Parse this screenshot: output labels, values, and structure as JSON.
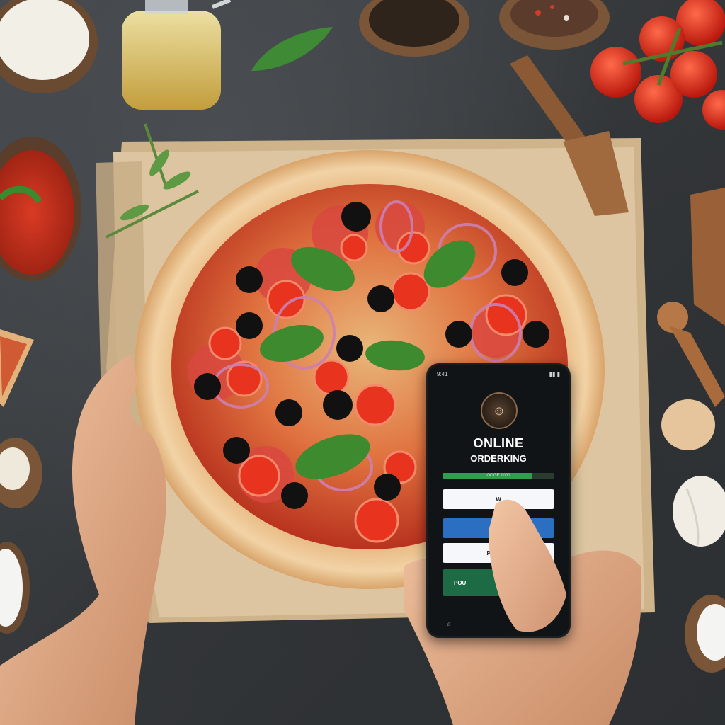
{
  "colors": {
    "background": "#3a3d40",
    "paper": "#d9c3a0",
    "sauce": "#c53d23",
    "crust": "#e9c08c",
    "phone_bg": "#111417",
    "primary_button": "#2b6fc2",
    "order_button": "#1d6b45",
    "accent_green": "#2f9e4f"
  },
  "scene_items": [
    "parmesan-bowl-icon",
    "olive-oil-bottle-icon",
    "basil-leaf-icon",
    "peppercorn-bowl-icon",
    "spice-bowl-icon",
    "cherry-tomatoes-icon",
    "wooden-fork-icon",
    "tomato-sauce-bowl-icon",
    "pizza-slice-icon",
    "salt-bowl-icon",
    "egg-icon",
    "garlic-icon",
    "pepper-mill-icon",
    "cutting-board-icon",
    "pizza-icon",
    "left-hand-icon",
    "right-hand-icon"
  ],
  "phone": {
    "title_line1": "ONLINE",
    "title_line2": "ORDERKING",
    "progress_label": "OOGE 1000",
    "progress_fraction": 0.8,
    "button1_label": "W",
    "button2_label": "O",
    "button3_label": "Pozelind",
    "button4_label": "POU",
    "logo_glyph": "☺",
    "search_icon": "⌕",
    "status_left": "9:41",
    "status_right": "▮▮ ▮"
  }
}
